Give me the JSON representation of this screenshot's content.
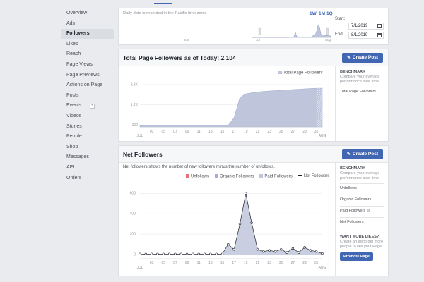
{
  "sidebar": {
    "items": [
      {
        "label": "Overview"
      },
      {
        "label": "Ads"
      },
      {
        "label": "Followers",
        "active": true
      },
      {
        "label": "Likes"
      },
      {
        "label": "Reach"
      },
      {
        "label": "Page Views"
      },
      {
        "label": "Page Previews"
      },
      {
        "label": "Actions on Page"
      },
      {
        "label": "Posts"
      },
      {
        "label": "Events",
        "has_plus": true
      },
      {
        "label": "Videos"
      },
      {
        "label": "Stories"
      },
      {
        "label": "People"
      },
      {
        "label": "Shop"
      },
      {
        "label": "Messages"
      },
      {
        "label": "API"
      },
      {
        "label": "Orders"
      }
    ],
    "plus_glyph": "+"
  },
  "timeline": {
    "note": "Daily data is recorded in the Pacific time zone.",
    "ranges": [
      "1W",
      "1M",
      "1Q"
    ],
    "start_label": "Start:",
    "start_value": "7/1/2019",
    "end_label": "End:",
    "end_value": "8/1/2019",
    "month_labels": [
      "Jun",
      "Jul",
      "Aug"
    ]
  },
  "total_followers": {
    "title": "Total Page Followers as of Today: 2,104",
    "button": "Create Post",
    "legend": "Total Page Followers",
    "benchmark_heading": "BENCHMARK",
    "benchmark_text": "Compare your average performance over time.",
    "benchmark_rows": [
      "Total Page Followers"
    ],
    "y_ticks": [
      "2.3K",
      "1.2K",
      "100"
    ],
    "x_ticks": [
      "03",
      "05",
      "07",
      "09",
      "11",
      "13",
      "15",
      "17",
      "19",
      "21",
      "23",
      "25",
      "27",
      "29",
      "31"
    ],
    "x_month_start": "JUL",
    "x_month_end": "AUG"
  },
  "net_followers": {
    "title": "Net Followers",
    "button": "Create Post",
    "subtitle": "Net followers shows the number of new followers minus the number of unfollows.",
    "legend": [
      {
        "label": "Unfollows",
        "color": "#e57373",
        "kind": "box"
      },
      {
        "label": "Organic Followers",
        "color": "#a3aed0",
        "kind": "box"
      },
      {
        "label": "Paid Followers",
        "color": "#bfc6dc",
        "kind": "box"
      },
      {
        "label": "Net Followers",
        "color": "#1d2129",
        "kind": "line"
      }
    ],
    "benchmark_heading": "BENCHMARK",
    "benchmark_text": "Compare your average performance over time.",
    "benchmark_rows": [
      "Unfollows",
      "Organic Followers",
      "Paid Followers",
      "Net Followers"
    ],
    "help_glyph": "?",
    "promo_heading": "WANT MORE LIKES?",
    "promo_text": "Create an ad to get more people to like your Page.",
    "promo_button": "Promote Page",
    "y_ticks": [
      "600",
      "400",
      "200",
      "0"
    ],
    "x_ticks": [
      "03",
      "05",
      "07",
      "09",
      "11",
      "13",
      "15",
      "17",
      "19",
      "21",
      "23",
      "25",
      "27",
      "29",
      "31"
    ],
    "x_month_start": "JUL",
    "x_month_end": "AUG"
  },
  "chart_data": [
    {
      "type": "area",
      "title": "Total Page Followers as of Today: 2,104",
      "series": [
        {
          "name": "Total Page Followers",
          "color": "#bfc6dc",
          "values": [
            80,
            80,
            80,
            80,
            80,
            80,
            80,
            80,
            80,
            80,
            80,
            80,
            80,
            80,
            80,
            80,
            500,
            1600,
            1800,
            1850,
            1900,
            1930,
            1950,
            1970,
            1990,
            2010,
            2030,
            2050,
            2070,
            2085,
            2100,
            2104
          ]
        }
      ],
      "x": [
        "01",
        "02",
        "03",
        "04",
        "05",
        "06",
        "07",
        "08",
        "09",
        "10",
        "11",
        "12",
        "13",
        "14",
        "15",
        "16",
        "17",
        "18",
        "19",
        "20",
        "21",
        "22",
        "23",
        "24",
        "25",
        "26",
        "27",
        "28",
        "29",
        "30",
        "31",
        "01"
      ],
      "ylim": [
        0,
        2300
      ]
    },
    {
      "type": "line",
      "title": "Net Followers",
      "x": [
        "01",
        "02",
        "03",
        "04",
        "05",
        "06",
        "07",
        "08",
        "09",
        "10",
        "11",
        "12",
        "13",
        "14",
        "15",
        "16",
        "17",
        "18",
        "19",
        "20",
        "21",
        "22",
        "23",
        "24",
        "25",
        "26",
        "27",
        "28",
        "29",
        "30",
        "31",
        "01"
      ],
      "series": [
        {
          "name": "Net Followers",
          "color": "#1d2129",
          "values": [
            5,
            5,
            5,
            5,
            5,
            5,
            5,
            5,
            5,
            5,
            5,
            5,
            5,
            5,
            5,
            100,
            50,
            300,
            600,
            310,
            50,
            30,
            40,
            30,
            50,
            20,
            60,
            20,
            70,
            40,
            30,
            10
          ]
        }
      ],
      "ylim": [
        0,
        650
      ]
    }
  ]
}
